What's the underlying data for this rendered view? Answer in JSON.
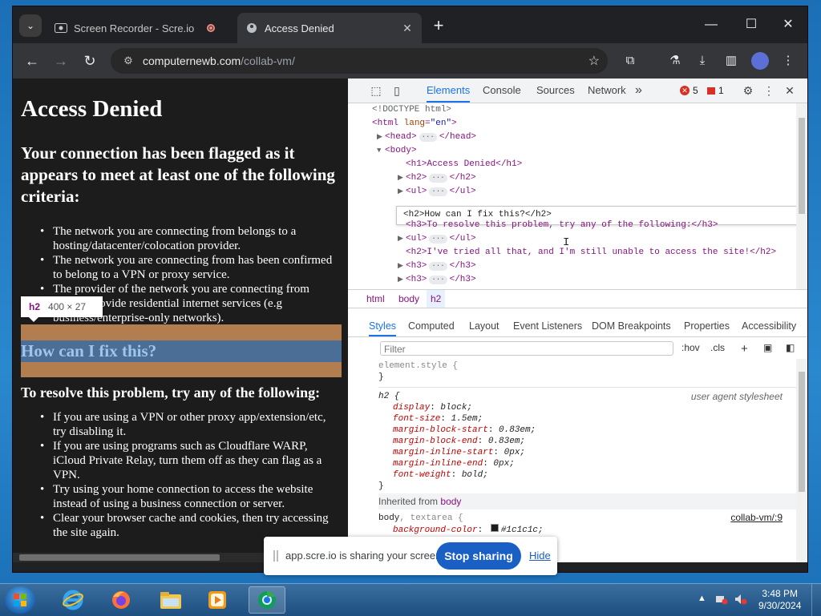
{
  "browser": {
    "tabs": [
      {
        "title": "Screen Recorder - Scre.io",
        "icon": "screen-recorder-icon",
        "recording": true
      },
      {
        "title": "Access Denied",
        "icon": "page-icon",
        "active": true
      }
    ],
    "new_tab": "+",
    "url_host": "computernewb.com",
    "url_path": "/collab-vm/"
  },
  "page": {
    "h1": "Access Denied",
    "h2_flagged": "Your connection has been flagged as it appears to meet at least one of the following criteria:",
    "criteria": [
      "The network you are connecting from belongs to a hosting/datacenter/colocation provider.",
      "The network you are connecting from has been confirmed to belong to a VPN or proxy service.",
      "The provider of the network you are connecting from doesn't provide residential internet services (e.g business/enterprise-only networks)."
    ],
    "h2_fix": "How can I fix this?",
    "h3_resolve": "To resolve this problem, try any of the following:",
    "fixes": [
      "If you are using a VPN or other proxy app/extension/etc, try disabling it.",
      "If you are using programs such as Cloudflare WARP, iCloud Private Relay, turn them off as they can flag as a VPN.",
      "Try using your home connection to access the website instead of using a business connection or server.",
      "Clear your browser cache and cookies, then try accessing the site again."
    ],
    "tooltip_tag": "h2",
    "tooltip_dim": "400 × 27"
  },
  "devtools": {
    "tabs": [
      "Elements",
      "Console",
      "Sources",
      "Network"
    ],
    "more": "»",
    "errors": "5",
    "warnings": "1",
    "dom": {
      "doctype": "<!DOCTYPE html>",
      "html_open": "<html",
      "html_attr": "lang",
      "html_val": "\"en\"",
      "head": "<head>",
      "head_close": "</head>",
      "body": "<body>",
      "h1": "<h1>Access Denied</h1>",
      "h2": "<h2>",
      "h2_close": "</h2>",
      "ul": "<ul>",
      "ul_close": "</ul>",
      "edit_row": "<h2>How can I fix this?</h2>",
      "h3_line": "<h3>To resolve this problem, try any of the following:</h3>",
      "h2_tried": "<h2>I've tried all that, and I'm still unable to access the site!</h2>",
      "h3": "<h3>",
      "h3_close": "</h3>",
      "ellipsis": "···"
    },
    "breadcrumbs": [
      "html",
      "body",
      "h2"
    ],
    "style_tabs": [
      "Styles",
      "Computed",
      "Layout",
      "Event Listeners",
      "DOM Breakpoints",
      "Properties",
      "Accessibility"
    ],
    "filter_placeholder": "Filter",
    "hov": ":hov",
    "cls": ".cls",
    "element_style": "element.style {",
    "close_brace": "}",
    "h2_rule": "h2 {",
    "ua_label": "user agent stylesheet",
    "h2_props": [
      {
        "p": "display",
        "v": "block;"
      },
      {
        "p": "font-size",
        "v": "1.5em;"
      },
      {
        "p": "margin-block-start",
        "v": "0.83em;"
      },
      {
        "p": "margin-block-end",
        "v": "0.83em;"
      },
      {
        "p": "margin-inline-start",
        "v": "0px;"
      },
      {
        "p": "margin-inline-end",
        "v": "0px;"
      },
      {
        "p": "font-weight",
        "v": "bold;"
      }
    ],
    "inherited_label": "Inherited from",
    "inherited_from": "body",
    "body_rule_sel": "body",
    "body_rule_extra": ", textarea {",
    "body_rule_src": "collab-vm/:9",
    "bg_prop": "background-color",
    "bg_val": "#1c1c1c;"
  },
  "share_bar": {
    "message": "app.scre.io is sharing your screen.",
    "stop": "Stop sharing",
    "hide": "Hide"
  },
  "taskbar": {
    "time": "3:48 PM",
    "date": "9/30/2024"
  }
}
